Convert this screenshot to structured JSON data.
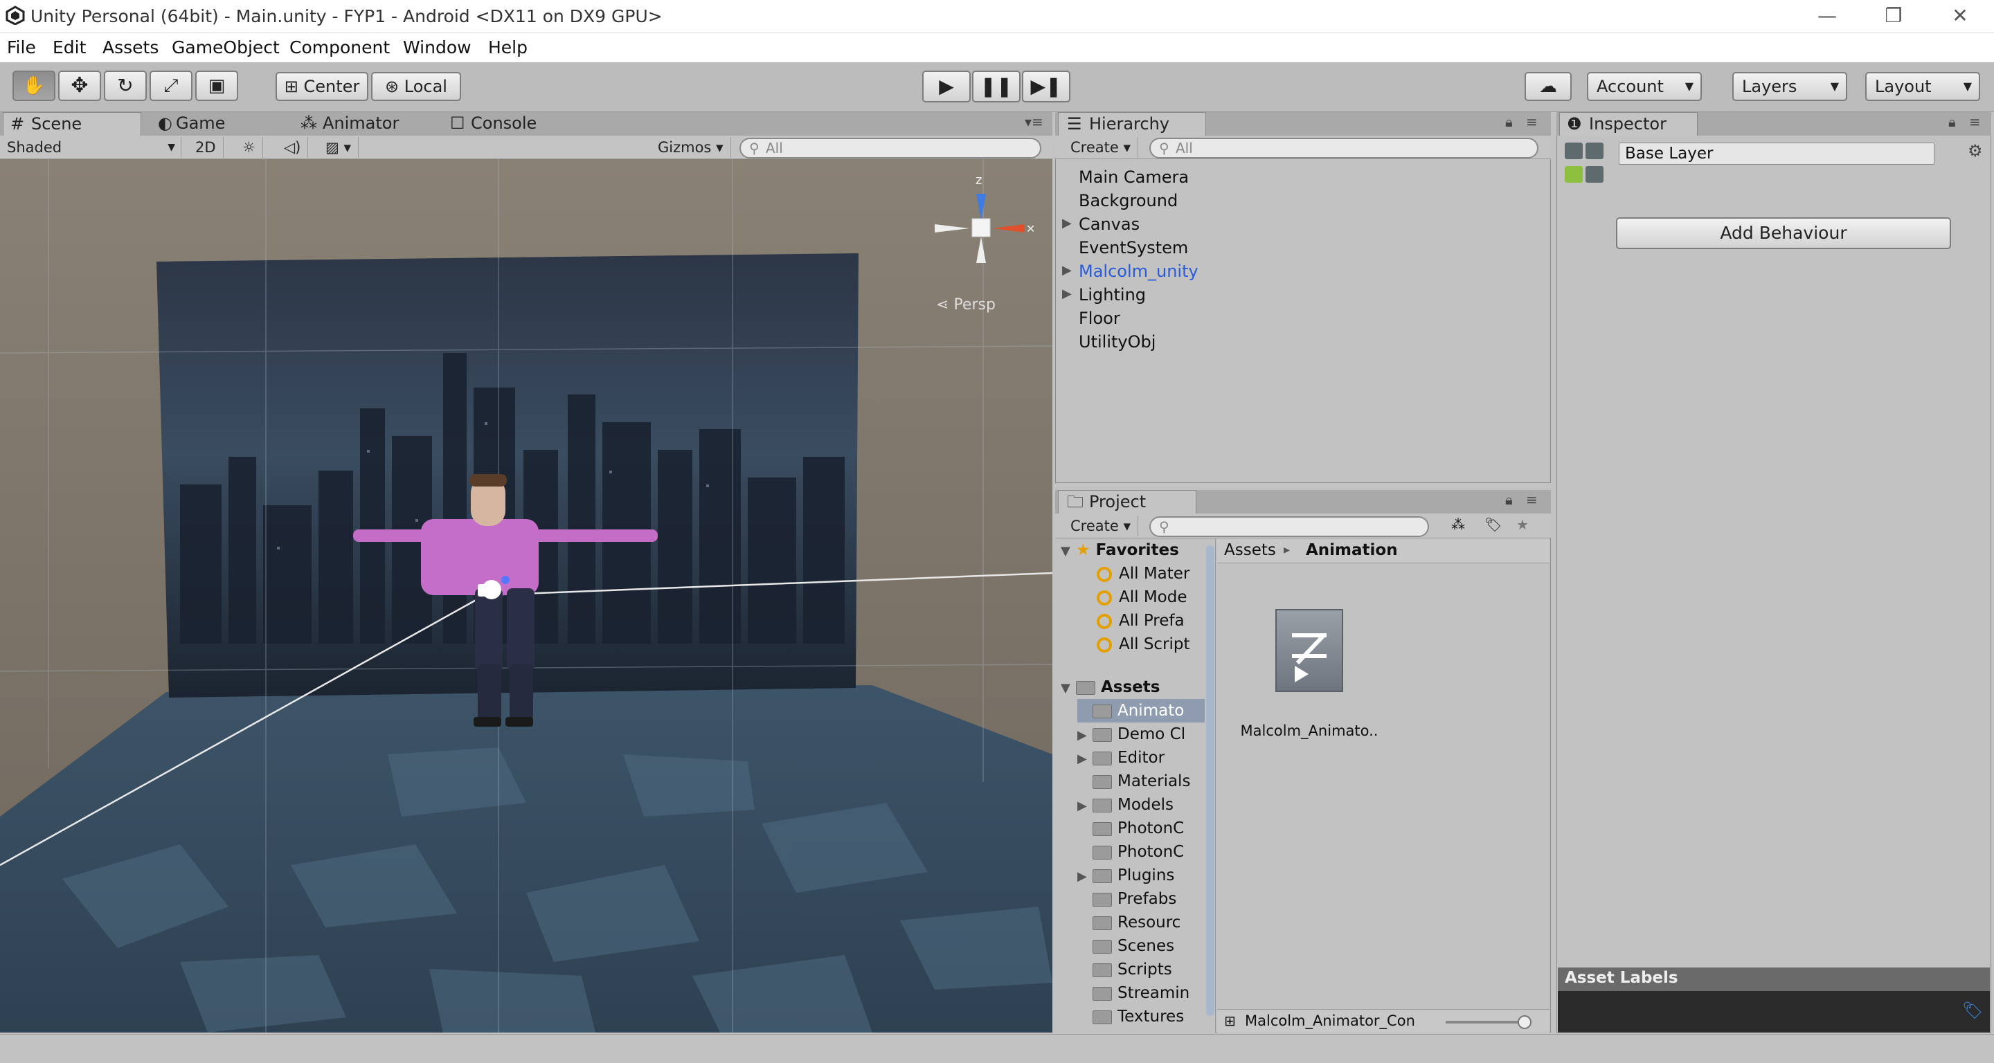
{
  "window": {
    "title": "Unity Personal (64bit) - Main.unity - FYP1 - Android <DX11 on DX9 GPU>",
    "minimize": "—",
    "maximize": "❐",
    "close": "✕"
  },
  "menu": [
    "File",
    "Edit",
    "Assets",
    "GameObject",
    "Component",
    "Window",
    "Help"
  ],
  "toolbar": {
    "pivot": "Center",
    "space": "Local",
    "account": "Account",
    "layers": "Layers",
    "layout": "Layout"
  },
  "scene_tabs": [
    "Scene",
    "Game",
    "Animator",
    "Console"
  ],
  "scene_bar": {
    "shading": "Shaded",
    "mode2d": "2D",
    "gizmos": "Gizmos",
    "search_placeholder": "All"
  },
  "gizmo": {
    "axis_label": "z",
    "projection": "Persp"
  },
  "hierarchy": {
    "tab": "Hierarchy",
    "create": "Create",
    "search_placeholder": "All",
    "items": [
      {
        "label": "Main Camera",
        "expandable": false,
        "selected": false
      },
      {
        "label": "Background",
        "expandable": false,
        "selected": false
      },
      {
        "label": "Canvas",
        "expandable": true,
        "selected": false
      },
      {
        "label": "EventSystem",
        "expandable": false,
        "selected": false
      },
      {
        "label": "Malcolm_unity",
        "expandable": true,
        "selected": false,
        "highlight": true
      },
      {
        "label": "Lighting",
        "expandable": true,
        "selected": false
      },
      {
        "label": "Floor",
        "expandable": false,
        "selected": false
      },
      {
        "label": "UtilityObj",
        "expandable": false,
        "selected": false
      }
    ]
  },
  "project": {
    "tab": "Project",
    "create": "Create",
    "favorites_label": "Favorites",
    "favorites": [
      "All Mater",
      "All Mode",
      "All Prefa",
      "All Script"
    ],
    "assets_label": "Assets",
    "folders": [
      {
        "label": "Animato",
        "expandable": false,
        "selected": true
      },
      {
        "label": "Demo Cl",
        "expandable": true,
        "selected": false
      },
      {
        "label": "Editor",
        "expandable": true,
        "selected": false
      },
      {
        "label": "Materials",
        "expandable": false,
        "selected": false
      },
      {
        "label": "Models",
        "expandable": true,
        "selected": false
      },
      {
        "label": "PhotonC",
        "expandable": false,
        "selected": false
      },
      {
        "label": "PhotonC",
        "expandable": false,
        "selected": false
      },
      {
        "label": "Plugins",
        "expandable": true,
        "selected": false
      },
      {
        "label": "Prefabs",
        "expandable": false,
        "selected": false
      },
      {
        "label": "Resourc",
        "expandable": false,
        "selected": false
      },
      {
        "label": "Scenes",
        "expandable": false,
        "selected": false
      },
      {
        "label": "Scripts",
        "expandable": false,
        "selected": false
      },
      {
        "label": "Streamin",
        "expandable": false,
        "selected": false
      },
      {
        "label": "Textures",
        "expandable": false,
        "selected": false
      }
    ],
    "breadcrumb_root": "Assets",
    "breadcrumb_sep": "▸",
    "breadcrumb_current": "Animation",
    "asset_name": "Malcolm_Animato..",
    "footer_item": "Malcolm_Animator_Con"
  },
  "inspector": {
    "tab": "Inspector",
    "layer_name": "Base Layer",
    "add_behaviour": "Add Behaviour",
    "asset_labels": "Asset Labels"
  },
  "colors": {
    "accent_blue": "#2a5bd7",
    "selection": "#8f9cb0",
    "panel_bg": "#c2c2c2"
  }
}
